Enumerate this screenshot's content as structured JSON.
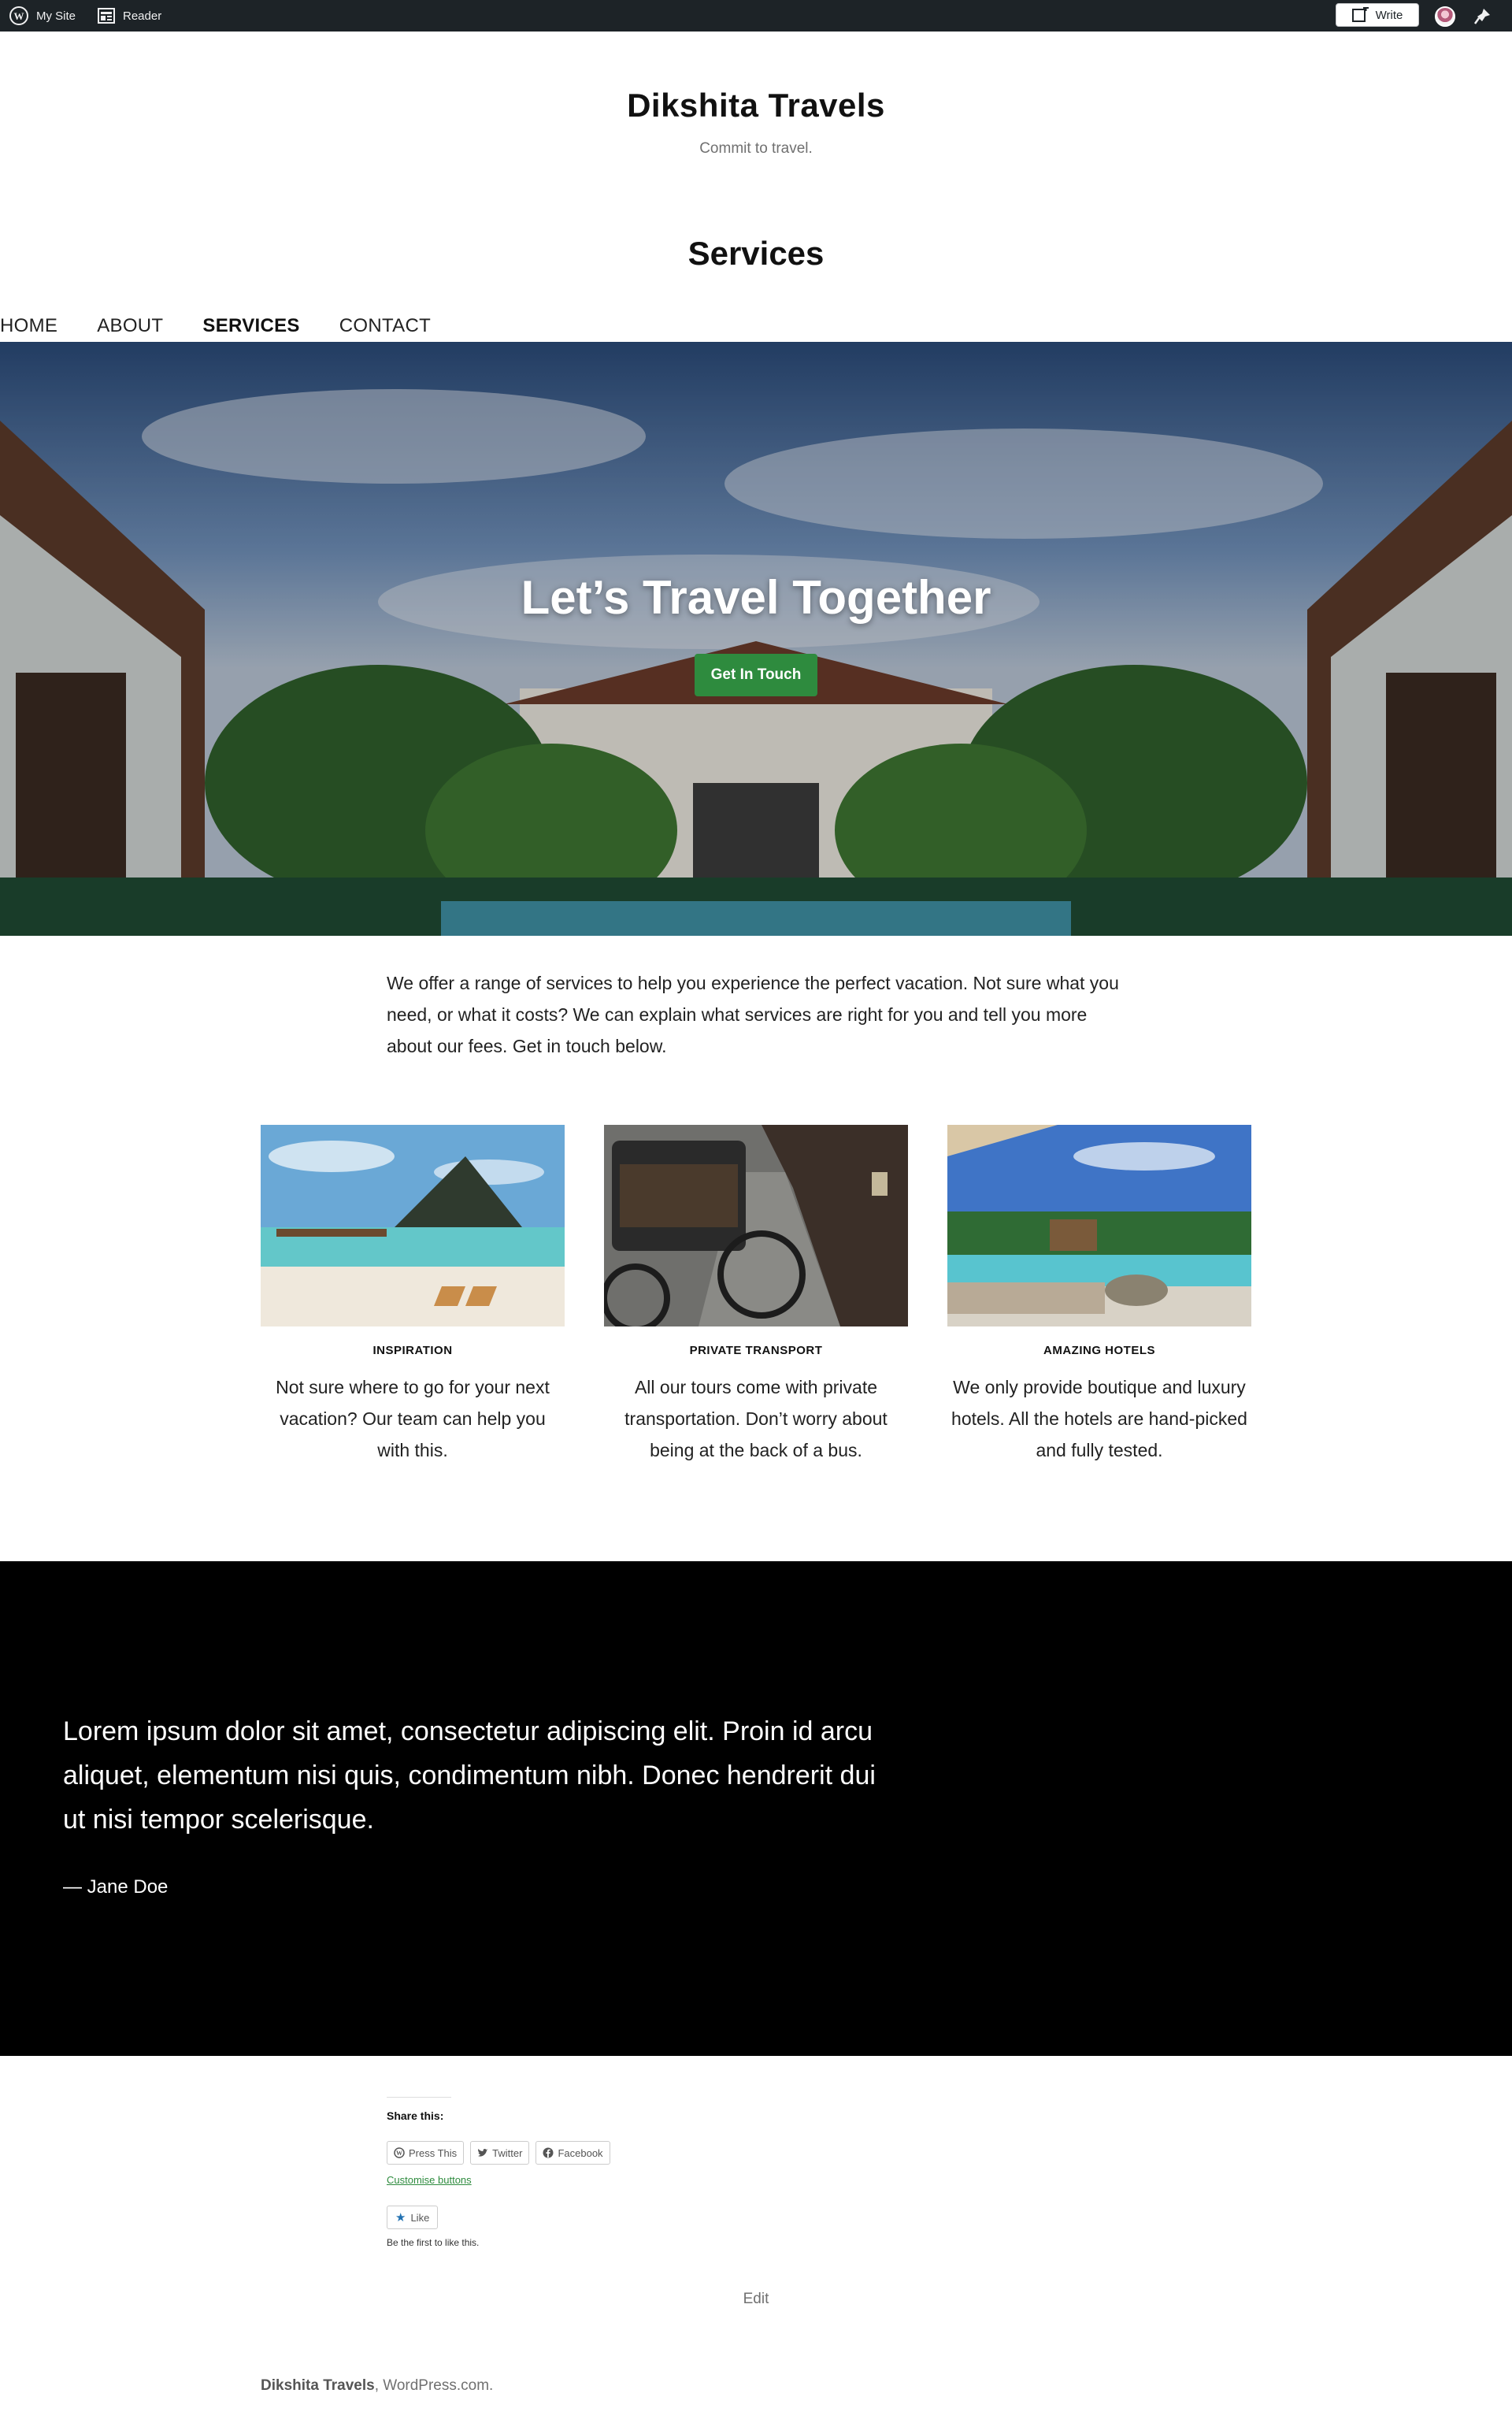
{
  "admin_bar": {
    "my_site": "My Site",
    "reader": "Reader",
    "write": "Write"
  },
  "site": {
    "title": "Dikshita Travels",
    "tagline": "Commit to travel."
  },
  "page_title": "Services",
  "nav": [
    "HOME",
    "ABOUT",
    "SERVICES",
    "CONTACT"
  ],
  "nav_current": "SERVICES",
  "hero": {
    "title": "Let’s Travel Together",
    "button": "Get In Touch",
    "button_color": "#2e8b3e"
  },
  "intro": "We offer a range of services to help you experience the perfect vacation. Not sure what you need, or what it costs? We can explain what services are right for you and tell you more about our fees. Get in touch below.",
  "services": [
    {
      "title": "INSPIRATION",
      "text": "Not sure where to go for your next vacation? Our team can help you with this."
    },
    {
      "title": "PRIVATE TRANSPORT",
      "text": "All our tours come with private transportation. Don’t worry about being at the back of a bus."
    },
    {
      "title": "AMAZING HOTELS",
      "text": "We only provide boutique and luxury hotels. All the hotels are hand-picked and fully tested."
    }
  ],
  "quote": {
    "text": "Lorem ipsum dolor sit amet, consectetur adipiscing elit. Proin id arcu aliquet, elementum nisi quis, condimentum nibh. Donec hendrerit dui ut nisi tempor scelerisque.",
    "cite": "— Jane Doe"
  },
  "share": {
    "title": "Share this:",
    "buttons": [
      "Press This",
      "Twitter",
      "Facebook"
    ],
    "customise": "Customise buttons",
    "like": "Like",
    "like_note": "Be the first to like this."
  },
  "edit": "Edit",
  "footer": {
    "site": "Dikshita Travels",
    "suffix": ", WordPress.com."
  }
}
